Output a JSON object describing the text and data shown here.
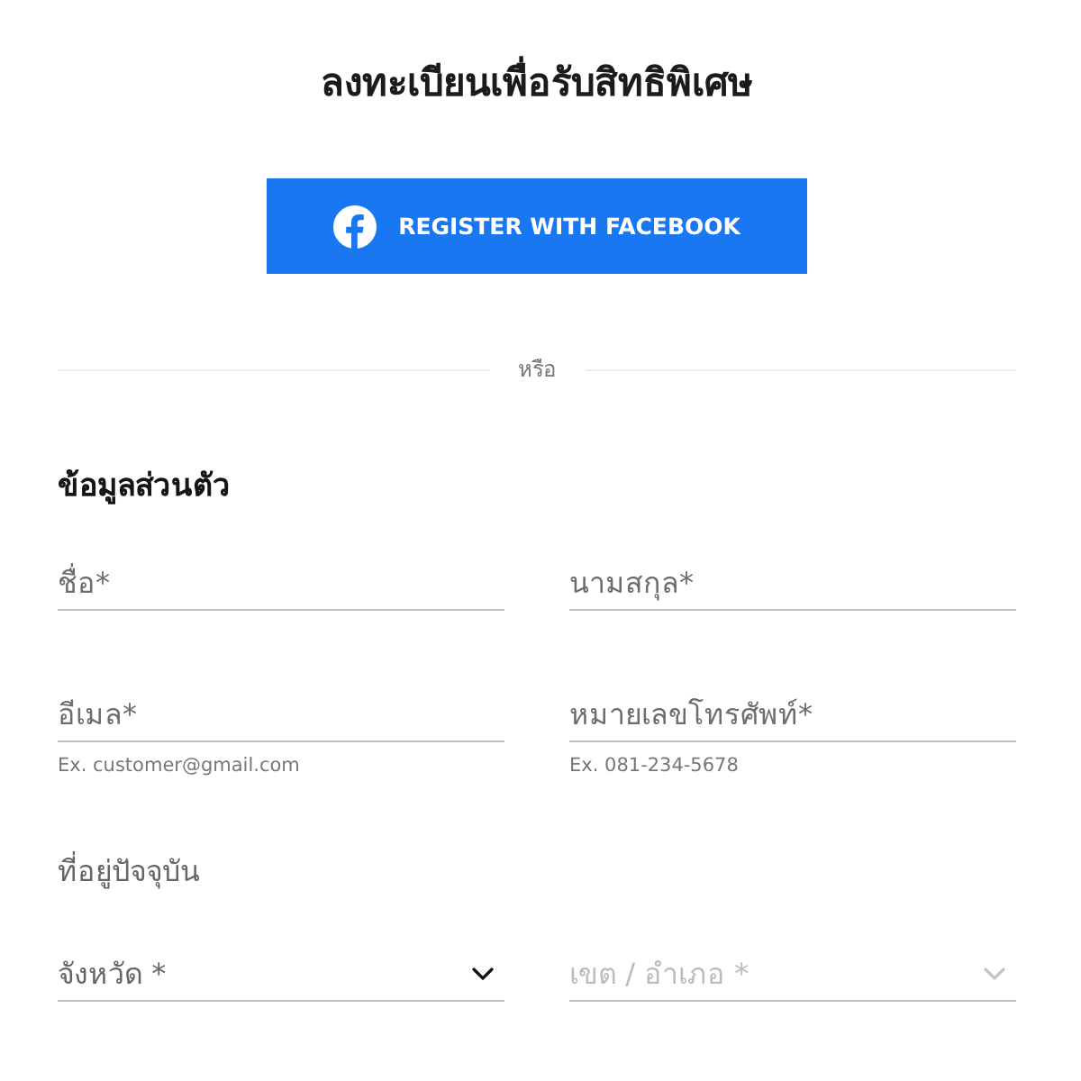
{
  "title": "ลงทะเบียนเพื่อรับสิทธิพิเศษ",
  "facebook_button": {
    "label": "REGISTER WITH FACEBOOK"
  },
  "divider": {
    "label": "หรือ"
  },
  "personal_section": {
    "heading": "ข้อมูลส่วนตัว",
    "fields": [
      {
        "placeholder": "ชื่อ*"
      },
      {
        "placeholder": "นามสกุล*"
      },
      {
        "placeholder": "อีเมล*",
        "hint": "Ex. customer@gmail.com"
      },
      {
        "placeholder": "หมายเลขโทรศัพท์*",
        "hint": "Ex. 081-234-5678"
      }
    ]
  },
  "address_section": {
    "heading": "ที่อยู่ปัจจุบัน",
    "selects": [
      {
        "placeholder": "จังหวัด *",
        "disabled": false
      },
      {
        "placeholder": "เขต / อำเภอ *",
        "disabled": true
      }
    ]
  }
}
